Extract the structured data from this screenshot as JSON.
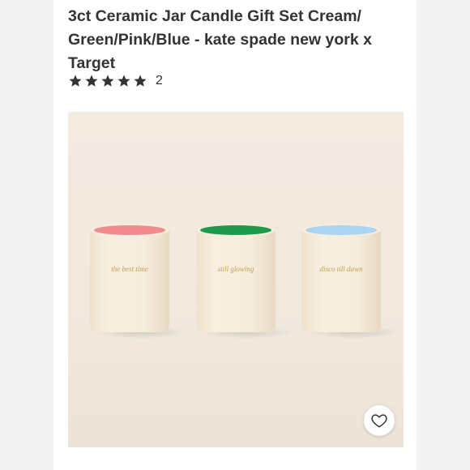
{
  "product": {
    "title": "3ct Ceramic Jar Candle Gift Set Cream/ Green/Pink/Blue - kate spade new york x Target",
    "rating_stars": 5,
    "rating_count": "2"
  },
  "image": {
    "candles": [
      {
        "label": "the best time",
        "rim_color": "#f08a8e"
      },
      {
        "label": "still glowing",
        "rim_color": "#1f9a4c"
      },
      {
        "label": "disco till dawn",
        "rim_color": "#a9d4f2"
      }
    ],
    "jar_color": "#f6ecdc",
    "label_color": "#c2a04a"
  },
  "actions": {
    "favorite_icon": "heart-outline-icon"
  }
}
